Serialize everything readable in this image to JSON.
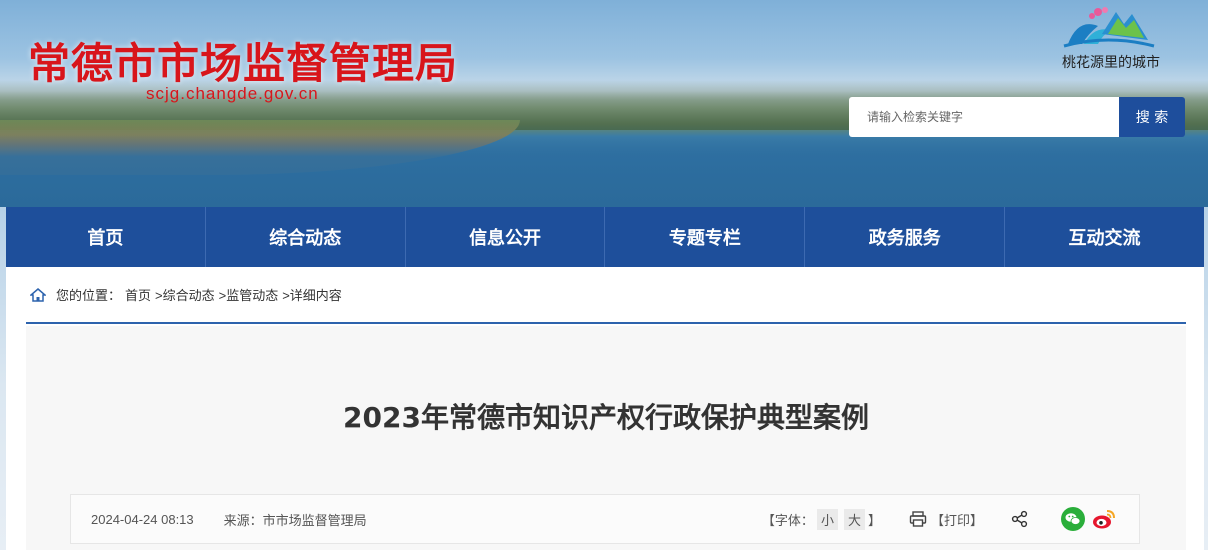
{
  "header": {
    "title": "常德市市场监督管理局",
    "domain": "scjg.changde.gov.cn",
    "city_slogan": "桃花源里的城市"
  },
  "search": {
    "placeholder": "请输入检索关键字",
    "button_label": "搜 索"
  },
  "nav": {
    "items": [
      "首页",
      "综合动态",
      "信息公开",
      "专题专栏",
      "政务服务",
      "互动交流"
    ]
  },
  "breadcrumb": {
    "prefix": "您的位置：",
    "items": [
      "首页",
      ">综合动态",
      ">监管动态",
      ">详细内容"
    ]
  },
  "article": {
    "title": "2023年常德市知识产权行政保护典型案例",
    "date": "2024-04-24 08:13",
    "source": "来源：市市场监督管理局",
    "font_label": "【字体：",
    "font_small": "小",
    "font_large": "大",
    "font_close": "】",
    "print_label": "【打印】"
  },
  "colors": {
    "accent": "#1e4f9b",
    "title_red": "#d8151b",
    "wechat": "#2aae3a",
    "weibo": "#e6162d"
  }
}
